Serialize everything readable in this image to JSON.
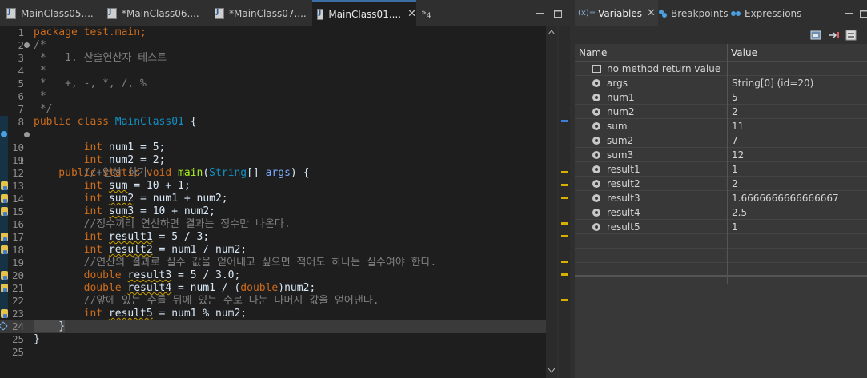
{
  "editor": {
    "tabs": [
      {
        "label": "MainClass05....",
        "active": false
      },
      {
        "label": "*MainClass06....",
        "active": false
      },
      {
        "label": "*MainClass07....",
        "active": false
      },
      {
        "label": "MainClass01....",
        "active": true
      }
    ],
    "overflow_label": "»",
    "overflow_count": "4",
    "lines": [
      {
        "n": "1"
      },
      {
        "n": "2"
      },
      {
        "n": "3"
      },
      {
        "n": "4"
      },
      {
        "n": "5"
      },
      {
        "n": "6"
      },
      {
        "n": "7"
      },
      {
        "n": "8"
      },
      {
        "n": "9"
      },
      {
        "n": "10"
      },
      {
        "n": "11"
      },
      {
        "n": "12"
      },
      {
        "n": "13"
      },
      {
        "n": "14"
      },
      {
        "n": "15"
      },
      {
        "n": "16"
      },
      {
        "n": "17"
      },
      {
        "n": "18"
      },
      {
        "n": "19"
      },
      {
        "n": "20"
      },
      {
        "n": "21"
      },
      {
        "n": "22"
      },
      {
        "n": "23"
      },
      {
        "n": "24"
      },
      {
        "n": "25"
      }
    ],
    "code": {
      "l1": "package test.main;",
      "l2": "/*",
      "l3": " *   1. 산술연산자 테스트",
      "l4": " *",
      "l5": " *   +, -, *, /, %",
      "l6": " *",
      "l7": " */",
      "l8_kw": "public class ",
      "l8_cls": "MainClass01",
      "l8_rest": " {",
      "l9_kw": "    public static void ",
      "l9_meth": "main",
      "l9_open": "(",
      "l9_typ": "String",
      "l9_mid": "[] ",
      "l9_var": "args",
      "l9_end": ") {",
      "l10_kw": "        int ",
      "l10_rest": "num1 = 5;",
      "l11_kw": "        int ",
      "l11_rest": "num2 = 2;",
      "l12": "        //+연산 하기",
      "l13_kw": "        int ",
      "l13_var": "sum",
      "l13_rest": " = 10 + 1;",
      "l14_kw": "        int ",
      "l14_var": "sum2",
      "l14_rest": " = num1 + num2;",
      "l15_kw": "        int ",
      "l15_var": "sum3",
      "l15_rest": " = 10 + num2;",
      "l16": "        //정수끼리 연산하면 결과는 정수만 나온다.",
      "l17_kw": "        int ",
      "l17_var": "result1",
      "l17_rest": " = 5 / 3;",
      "l18_kw": "        int ",
      "l18_var": "result2",
      "l18_rest": " = num1 / num2;",
      "l19": "        //연산의 결과로 실수 값을 얻어내고 싶으면 적어도 하나는 실수여야 한다.",
      "l20_kw": "        double ",
      "l20_var": "result3",
      "l20_rest": " = 5 / 3.0;",
      "l21_kw": "        double ",
      "l21_var": "result4",
      "l21_mid": " = num1 / (",
      "l21_kw2": "double",
      "l21_rest": ")num2;",
      "l22": "        //앞에 있는 수를 뒤에 있는 수로 나눈 나머지 값을 얻어낸다.",
      "l23_kw": "        int ",
      "l23_var": "result5",
      "l23_rest": " = num1 % num2;",
      "l24": "    }",
      "l25": "}"
    }
  },
  "variables_view": {
    "tabs": [
      {
        "label": "Variables",
        "prefix": "(x)=",
        "active": true
      },
      {
        "label": "Breakpoints",
        "active": false
      },
      {
        "label": "Expressions",
        "active": false
      }
    ],
    "columns": {
      "name": "Name",
      "value": "Value"
    },
    "rows": [
      {
        "name": "no method return value",
        "value": ""
      },
      {
        "name": "args",
        "value": "String[0]  (id=20)"
      },
      {
        "name": "num1",
        "value": "5"
      },
      {
        "name": "num2",
        "value": "2"
      },
      {
        "name": "sum",
        "value": "11"
      },
      {
        "name": "sum2",
        "value": "7"
      },
      {
        "name": "sum3",
        "value": "12"
      },
      {
        "name": "result1",
        "value": "1"
      },
      {
        "name": "result2",
        "value": "2"
      },
      {
        "name": "result3",
        "value": "1.6666666666666667"
      },
      {
        "name": "result4",
        "value": "2.5"
      },
      {
        "name": "result5",
        "value": "1"
      }
    ]
  },
  "colors": {
    "keyword": "#cc6c1d",
    "class_name": "#1290c3",
    "method": "#a7ec21",
    "comment": "#808080",
    "warning_marker": "#d8b000"
  }
}
